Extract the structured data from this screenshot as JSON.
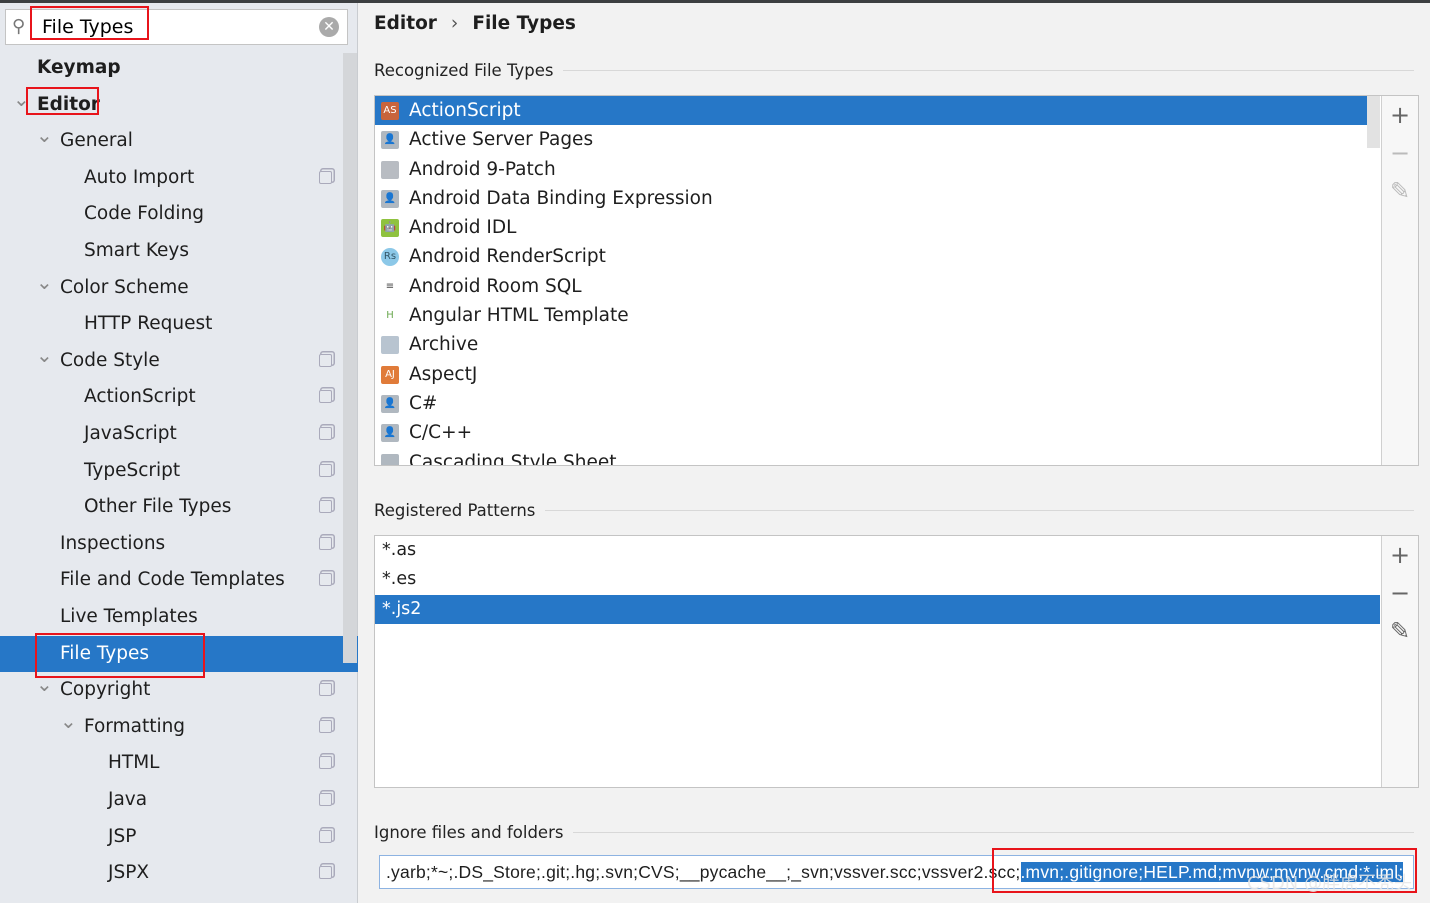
{
  "search": {
    "value": "File Types",
    "icon": "search-icon",
    "clear_icon": "clear-icon"
  },
  "tree": [
    {
      "label": "Keymap",
      "level": 0,
      "bold": true
    },
    {
      "label": "Editor",
      "level": 0,
      "bold": true,
      "expanded": true
    },
    {
      "label": "General",
      "level": 1,
      "expanded": true
    },
    {
      "label": "Auto Import",
      "level": 2,
      "copy": true
    },
    {
      "label": "Code Folding",
      "level": 2
    },
    {
      "label": "Smart Keys",
      "level": 2
    },
    {
      "label": "Color Scheme",
      "level": 1,
      "expanded": true
    },
    {
      "label": "HTTP Request",
      "level": 2
    },
    {
      "label": "Code Style",
      "level": 1,
      "expanded": true,
      "copy": true
    },
    {
      "label": "ActionScript",
      "level": 2,
      "copy": true
    },
    {
      "label": "JavaScript",
      "level": 2,
      "copy": true
    },
    {
      "label": "TypeScript",
      "level": 2,
      "copy": true
    },
    {
      "label": "Other File Types",
      "level": 2,
      "copy": true
    },
    {
      "label": "Inspections",
      "level": 1,
      "copy": true
    },
    {
      "label": "File and Code Templates",
      "level": 1,
      "copy": true
    },
    {
      "label": "Live Templates",
      "level": 1
    },
    {
      "label": "File Types",
      "level": 1,
      "selected": true
    },
    {
      "label": "Copyright",
      "level": 1,
      "expanded": true,
      "copy": true
    },
    {
      "label": "Formatting",
      "level": 2,
      "expanded": true,
      "copy": true
    },
    {
      "label": "HTML",
      "level": 3,
      "copy": true
    },
    {
      "label": "Java",
      "level": 3,
      "copy": true
    },
    {
      "label": "JSP",
      "level": 3,
      "copy": true
    },
    {
      "label": "JSPX",
      "level": 3,
      "copy": true
    }
  ],
  "breadcrumb": {
    "parent": "Editor",
    "separator": "›",
    "current": "File Types"
  },
  "recognized": {
    "title": "Recognized File Types",
    "items": [
      {
        "label": "ActionScript",
        "icon": "AS",
        "color": "#c8643c",
        "selected": true
      },
      {
        "label": "Active Server Pages",
        "icon": "👤",
        "color": "#b0b8c0"
      },
      {
        "label": "Android 9-Patch",
        "icon": "",
        "color": "#b8bcc2"
      },
      {
        "label": "Android Data Binding Expression",
        "icon": "👤",
        "color": "#b0b8c0"
      },
      {
        "label": "Android IDL",
        "icon": "🤖",
        "color": "#8fc23f"
      },
      {
        "label": "Android RenderScript",
        "icon": "Rs",
        "color": "#8cc8e8"
      },
      {
        "label": "Android Room SQL",
        "icon": "≡",
        "color": "#444"
      },
      {
        "label": "Angular HTML Template",
        "icon": "H",
        "color": "#6aa84f"
      },
      {
        "label": "Archive",
        "icon": "▥",
        "color": "#b8c4d0"
      },
      {
        "label": "AspectJ",
        "icon": "AJ",
        "color": "#e07b39"
      },
      {
        "label": "C#",
        "icon": "👤",
        "color": "#b0b8c0"
      },
      {
        "label": "C/C++",
        "icon": "👤",
        "color": "#b0b8c0"
      },
      {
        "label": "Cascading Style Sheet",
        "icon": "",
        "color": "#b0b8c0"
      }
    ]
  },
  "patterns": {
    "title": "Registered Patterns",
    "items": [
      {
        "label": "*.as"
      },
      {
        "label": "*.es"
      },
      {
        "label": "*.js2",
        "selected": true
      }
    ]
  },
  "tools": {
    "add": "+",
    "remove": "−",
    "edit": "✎"
  },
  "ignore": {
    "title": "Ignore files and folders",
    "value_plain": ".yarb;*~;.DS_Store;.git;.hg;.svn;CVS;__pycache__;_svn;vssver.scc;vssver2.scc;",
    "value_selected": ".mvn;.gitignore;HELP.md;mvnw;mvnw.cmd;*.iml;"
  },
  "watermark": "CSDN @胖虎不秃头",
  "colors": {
    "selection": "#2677c7",
    "highlight_box": "#e8141b"
  }
}
